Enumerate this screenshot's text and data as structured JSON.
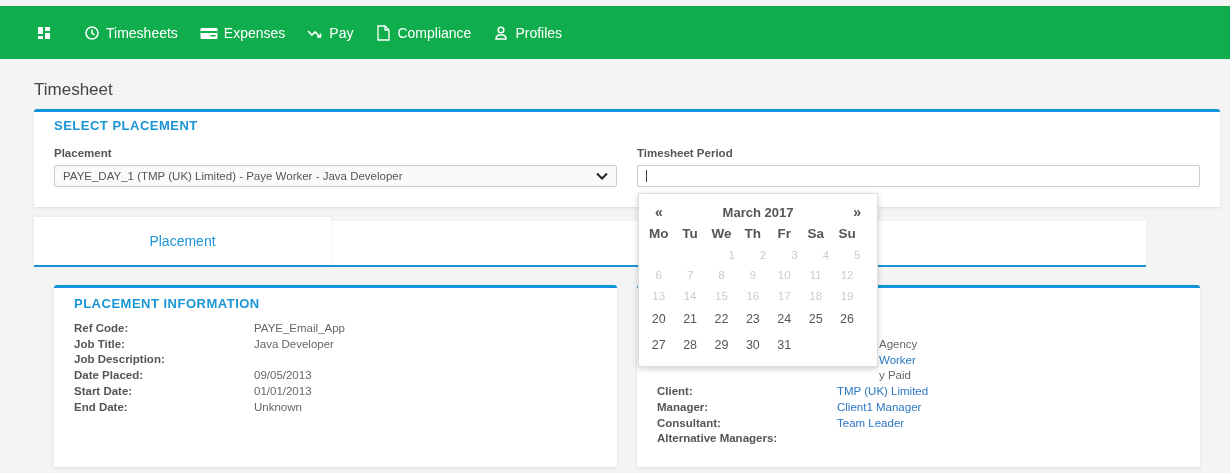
{
  "nav": {
    "items": [
      {
        "kind": "dashboard"
      },
      {
        "kind": "clock",
        "label": "Timesheets"
      },
      {
        "kind": "card",
        "label": "Expenses"
      },
      {
        "kind": "trend",
        "label": "Pay"
      },
      {
        "kind": "doc",
        "label": "Compliance"
      },
      {
        "kind": "person",
        "label": "Profiles"
      }
    ]
  },
  "page_title": "Timesheet",
  "select_placement": {
    "title": "SELECT PLACEMENT",
    "placement_label": "Placement",
    "placement_value": "PAYE_DAY_1 (TMP (UK) Limited) - Paye Worker - Java Developer",
    "period_label": "Timesheet Period"
  },
  "tabs": [
    {
      "label": "Placement",
      "selected": true
    }
  ],
  "placement_info": {
    "title": "PLACEMENT INFORMATION",
    "rows": [
      {
        "label": "Ref Code:",
        "value": "PAYE_Email_App"
      },
      {
        "label": "Job Title:",
        "value": "Java Developer"
      },
      {
        "label": "Job Description:"
      },
      {
        "label": "Date Placed:",
        "value": "09/05/2013"
      },
      {
        "label": "Start Date:",
        "value": "01/01/2013"
      },
      {
        "label": "End Date:",
        "value": "Unknown"
      }
    ]
  },
  "right_card": {
    "rows": [
      {
        "value": "Agency"
      },
      {
        "value": "Worker",
        "kind": "link"
      },
      {
        "value": "y Paid"
      },
      {
        "label": "Client:",
        "value": "TMP (UK) Limited",
        "kind": "link"
      },
      {
        "label": "Manager:",
        "value": "Client1 Manager",
        "kind": "link"
      },
      {
        "label": "Consultant:",
        "value": "Team Leader",
        "kind": "link"
      },
      {
        "label": "Alternative Managers:"
      }
    ]
  },
  "calendar": {
    "prev": "«",
    "month": "March 2017",
    "next": "»",
    "weekdays": [
      "Mo",
      "Tu",
      "We",
      "Th",
      "Fr",
      "Sa",
      "Su"
    ],
    "weeks": [
      [
        {
          "day": "1",
          "disabled": true
        },
        {
          "day": "2",
          "disabled": true
        },
        {
          "day": "3",
          "disabled": true
        },
        {
          "day": "4",
          "disabled": true
        },
        {
          "day": "5",
          "disabled": true
        }
      ],
      [
        {
          "day": "6",
          "disabled": true
        },
        {
          "day": "7",
          "disabled": true
        },
        {
          "day": "8",
          "disabled": true
        },
        {
          "day": "9",
          "disabled": true
        },
        {
          "day": "10",
          "disabled": true
        },
        {
          "day": "11",
          "disabled": true
        },
        {
          "day": "12",
          "disabled": true
        }
      ],
      [
        {
          "day": "13",
          "disabled": true
        },
        {
          "day": "14",
          "disabled": true
        },
        {
          "day": "15",
          "disabled": true
        },
        {
          "day": "16",
          "disabled": true
        },
        {
          "day": "17",
          "disabled": true
        },
        {
          "day": "18",
          "disabled": true
        },
        {
          "day": "19",
          "disabled": true
        }
      ],
      [
        {
          "day": "20",
          "disabled": false
        },
        {
          "day": "21",
          "disabled": false
        },
        {
          "day": "22",
          "disabled": false
        },
        {
          "day": "23",
          "disabled": false
        },
        {
          "day": "24",
          "disabled": false
        },
        {
          "day": "25",
          "disabled": false
        },
        {
          "day": "26",
          "disabled": false
        }
      ],
      [
        {
          "day": "27",
          "disabled": false
        },
        {
          "day": "28",
          "disabled": false
        },
        {
          "day": "29",
          "disabled": false
        },
        {
          "day": "30",
          "disabled": false
        },
        {
          "day": "31",
          "disabled": false
        }
      ]
    ]
  }
}
